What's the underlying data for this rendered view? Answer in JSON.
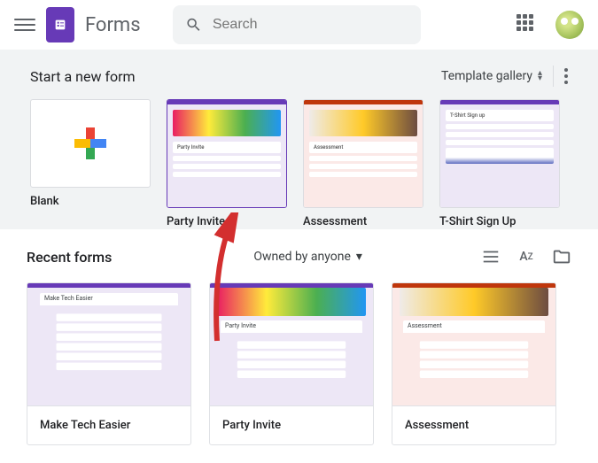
{
  "header": {
    "app_title": "Forms",
    "search_placeholder": "Search"
  },
  "templates": {
    "section_title": "Start a new form",
    "gallery_label": "Template gallery",
    "items": [
      {
        "label": "Blank"
      },
      {
        "label": "Party Invite"
      },
      {
        "label": "Assessment"
      },
      {
        "label": "T-Shirt Sign Up"
      }
    ]
  },
  "recent": {
    "section_title": "Recent forms",
    "filter_label": "Owned by anyone",
    "items": [
      {
        "title": "Make Tech Easier"
      },
      {
        "title": "Party Invite"
      },
      {
        "title": "Assessment"
      }
    ]
  },
  "thumbs": {
    "party_title": "Party Invite",
    "assessment_title": "Assessment",
    "tshirt_title": "T-Shirt Sign up",
    "mte_title": "Make Tech Easier"
  }
}
